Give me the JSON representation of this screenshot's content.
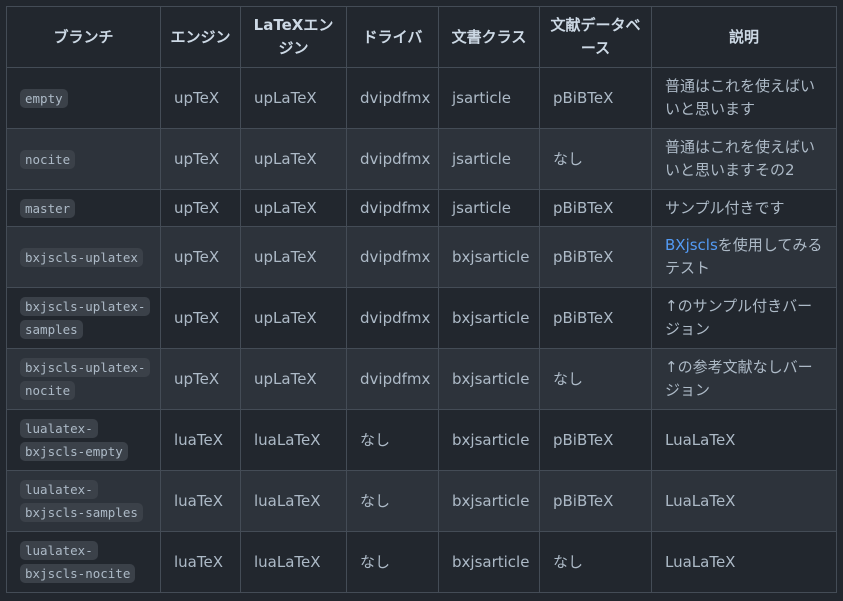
{
  "table": {
    "headers": [
      "ブランチ",
      "エンジン",
      "LaTeXエンジン",
      "ドライバ",
      "文書クラス",
      "文献データベース",
      "説明"
    ],
    "rows": [
      {
        "branch": "empty",
        "engine": "upTeX",
        "latex_engine": "upLaTeX",
        "driver": "dvipdfmx",
        "doc_class": "jsarticle",
        "bib_db": "pBiBTeX",
        "desc_link": "",
        "desc": "普通はこれを使えばいいと思います"
      },
      {
        "branch": "nocite",
        "engine": "upTeX",
        "latex_engine": "upLaTeX",
        "driver": "dvipdfmx",
        "doc_class": "jsarticle",
        "bib_db": "なし",
        "desc_link": "",
        "desc": "普通はこれを使えばいいと思いますその2"
      },
      {
        "branch": "master",
        "engine": "upTeX",
        "latex_engine": "upLaTeX",
        "driver": "dvipdfmx",
        "doc_class": "jsarticle",
        "bib_db": "pBiBTeX",
        "desc_link": "",
        "desc": "サンプル付きです"
      },
      {
        "branch": "bxjscls-uplatex",
        "engine": "upTeX",
        "latex_engine": "upLaTeX",
        "driver": "dvipdfmx",
        "doc_class": "bxjsarticle",
        "bib_db": "pBiBTeX",
        "desc_link": "BXjscls",
        "desc": "を使用してみるテスト"
      },
      {
        "branch": "bxjscls-uplatex-samples",
        "engine": "upTeX",
        "latex_engine": "upLaTeX",
        "driver": "dvipdfmx",
        "doc_class": "bxjsarticle",
        "bib_db": "pBiBTeX",
        "desc_link": "",
        "desc": "↑のサンプル付きバージョン"
      },
      {
        "branch": "bxjscls-uplatex-nocite",
        "engine": "upTeX",
        "latex_engine": "upLaTeX",
        "driver": "dvipdfmx",
        "doc_class": "bxjsarticle",
        "bib_db": "なし",
        "desc_link": "",
        "desc": "↑の参考文献なしバージョン"
      },
      {
        "branch": "lualatex-bxjscls-empty",
        "engine": "luaTeX",
        "latex_engine": "luaLaTeX",
        "driver": "なし",
        "doc_class": "bxjsarticle",
        "bib_db": "pBiBTeX",
        "desc_link": "",
        "desc": "LuaLaTeX"
      },
      {
        "branch": "lualatex-bxjscls-samples",
        "engine": "luaTeX",
        "latex_engine": "luaLaTeX",
        "driver": "なし",
        "doc_class": "bxjsarticle",
        "bib_db": "pBiBTeX",
        "desc_link": "",
        "desc": "LuaLaTeX"
      },
      {
        "branch": "lualatex-bxjscls-nocite",
        "engine": "luaTeX",
        "latex_engine": "luaLaTeX",
        "driver": "なし",
        "doc_class": "bxjsarticle",
        "bib_db": "なし",
        "desc_link": "",
        "desc": "LuaLaTeX"
      }
    ]
  }
}
